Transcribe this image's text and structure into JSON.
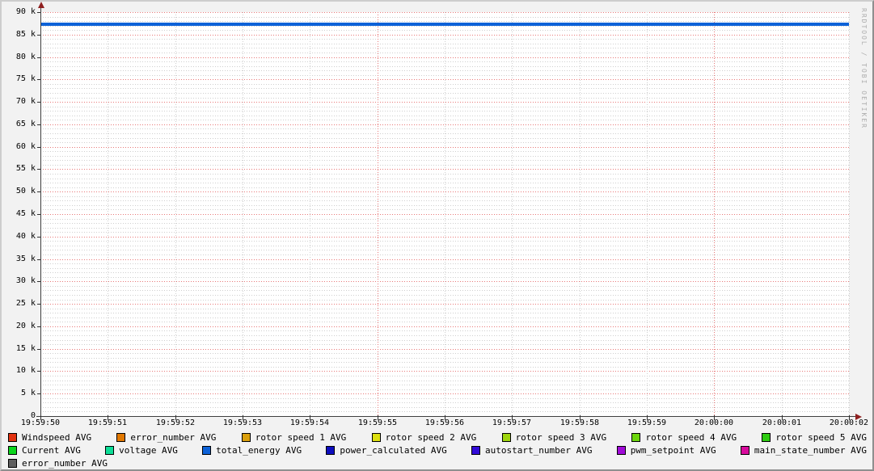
{
  "watermark": "RRDTOOL / TOBI OETIKER",
  "colors": {
    "background": "#f2f2f2",
    "canvas": "#ffffff",
    "major_grid": "#e87878",
    "minor_grid": "#cfcfcf",
    "axis": "#404040",
    "arrow": "#8f2020",
    "watermark_text": "#adadad"
  },
  "chart_data": {
    "type": "line",
    "title": "",
    "xlabel": "",
    "ylabel": "",
    "grid": "on",
    "legend_position": "bottom",
    "x_tick_labels": [
      "19:59:50",
      "19:59:51",
      "19:59:52",
      "19:59:53",
      "19:59:54",
      "19:59:55",
      "19:59:56",
      "19:59:57",
      "19:59:58",
      "19:59:59",
      "20:00:00",
      "20:00:01",
      "20:00:02"
    ],
    "x_major_ticks": [
      "19:59:55",
      "20:00:00"
    ],
    "ylim": [
      0,
      90000
    ],
    "y_major_step": 5000,
    "y_minor_step": 1000,
    "y_tick_labels": [
      {
        "value": 0,
        "label": "0"
      },
      {
        "value": 5000,
        "label": "5 k"
      },
      {
        "value": 10000,
        "label": "10 k"
      },
      {
        "value": 15000,
        "label": "15 k"
      },
      {
        "value": 20000,
        "label": "20 k"
      },
      {
        "value": 25000,
        "label": "25 k"
      },
      {
        "value": 30000,
        "label": "30 k"
      },
      {
        "value": 35000,
        "label": "35 k"
      },
      {
        "value": 40000,
        "label": "40 k"
      },
      {
        "value": 45000,
        "label": "45 k"
      },
      {
        "value": 50000,
        "label": "50 k"
      },
      {
        "value": 55000,
        "label": "55 k"
      },
      {
        "value": 60000,
        "label": "60 k"
      },
      {
        "value": 65000,
        "label": "65 k"
      },
      {
        "value": 70000,
        "label": "70 k"
      },
      {
        "value": 75000,
        "label": "75 k"
      },
      {
        "value": 80000,
        "label": "80 k"
      },
      {
        "value": 85000,
        "label": "85 k"
      },
      {
        "value": 90000,
        "label": "90 k"
      }
    ],
    "series": [
      {
        "name": "total_energy AVG",
        "color": "#0d62d8",
        "values": [
          87300,
          87300,
          87300,
          87300,
          87300,
          87300,
          87300,
          87300,
          87300,
          87300,
          87300,
          87300,
          87300
        ]
      }
    ],
    "legend_rows": [
      [
        {
          "label": "Windspeed AVG",
          "color": "#e23210"
        },
        {
          "label": "error_number AVG",
          "color": "#e17800"
        },
        {
          "label": "rotor speed 1 AVG",
          "color": "#dba00c"
        },
        {
          "label": "rotor speed 2 AVG",
          "color": "#dde010"
        },
        {
          "label": "rotor speed 3 AVG",
          "color": "#9fd60e"
        },
        {
          "label": "rotor speed 4 AVG",
          "color": "#6cd60c"
        },
        {
          "label": "rotor speed 5 AVG",
          "color": "#2ecc11"
        }
      ],
      [
        {
          "label": "Current AVG",
          "color": "#0bd51d"
        },
        {
          "label": "voltage AVG",
          "color": "#0cdd96"
        },
        {
          "label": "total_energy AVG",
          "color": "#0d62d8"
        },
        {
          "label": "power_calculated AVG",
          "color": "#0d0dbe"
        },
        {
          "label": "autostart_number AVG",
          "color": "#320bd8"
        },
        {
          "label": "pwm_setpoint AVG",
          "color": "#a00bd8"
        },
        {
          "label": "main_state_number AVG",
          "color": "#d80b9d"
        }
      ],
      [
        {
          "label": "error_number AVG",
          "color": "#5f5f5f"
        }
      ]
    ]
  }
}
